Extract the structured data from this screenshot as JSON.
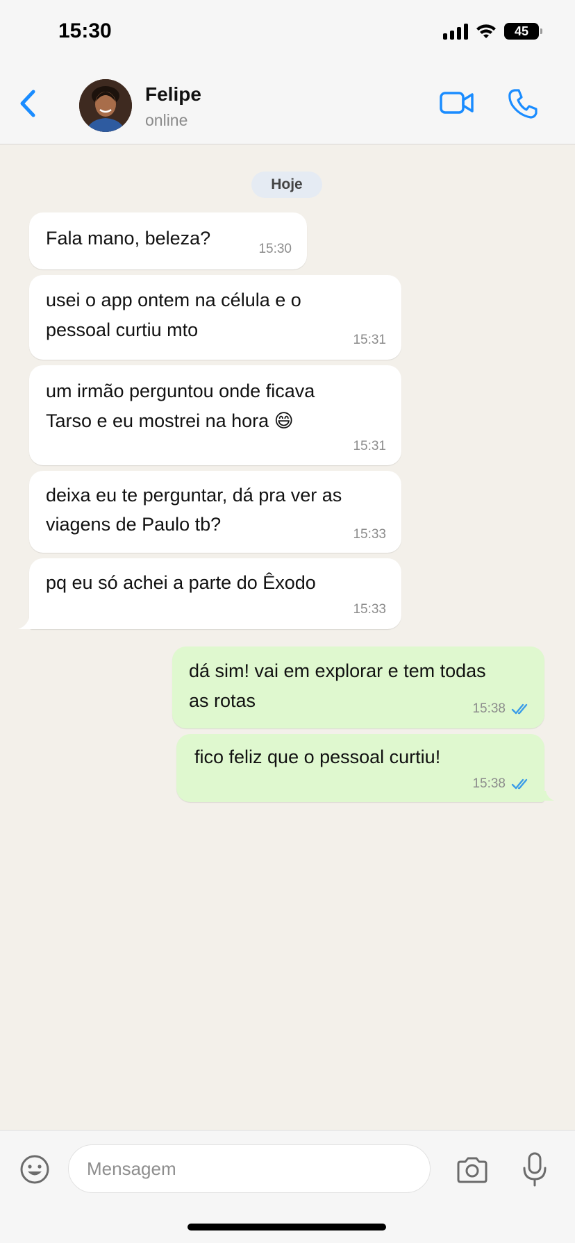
{
  "status_bar": {
    "time": "15:30",
    "battery": "45"
  },
  "header": {
    "contact_name": "Felipe",
    "contact_status": "online"
  },
  "chat": {
    "date_label": "Hoje",
    "messages": [
      {
        "direction": "in",
        "lines": [
          "Fala mano, beleza?"
        ],
        "time": "15:30"
      },
      {
        "direction": "in",
        "lines": [
          "usei o app ontem na célula e o",
          "pessoal curtiu mto"
        ],
        "time": "15:31"
      },
      {
        "direction": "in",
        "lines": [
          "um irmão perguntou onde ficava",
          "Tarso e eu mostrei na hora 😄"
        ],
        "time": "15:31"
      },
      {
        "direction": "in",
        "lines": [
          "deixa eu te perguntar, dá pra ver as",
          "viagens de Paulo tb?"
        ],
        "time": "15:33"
      },
      {
        "direction": "in",
        "lines": [
          "pq eu só achei a parte do Êxodo"
        ],
        "time": "15:33"
      },
      {
        "direction": "out",
        "lines": [
          "dá sim! vai em explorar e tem todas",
          "as rotas"
        ],
        "time": "15:38",
        "status": "read"
      },
      {
        "direction": "out",
        "lines": [
          "fico feliz que o pessoal curtiu!"
        ],
        "time": "15:38",
        "status": "read"
      }
    ]
  },
  "composer": {
    "placeholder": "Mensagem",
    "value": ""
  },
  "colors": {
    "accent": "#1a8cff",
    "incoming_bubble": "#ffffff",
    "outgoing_bubble": "#dff8cf",
    "read_ticks": "#3a9ce8"
  },
  "icons": [
    "back-chevron-icon",
    "video-call-icon",
    "phone-icon",
    "emoji-icon",
    "camera-icon",
    "microphone-icon",
    "read-ticks-icon"
  ]
}
